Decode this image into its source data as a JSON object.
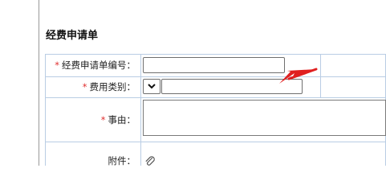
{
  "form": {
    "title": "经费申请单",
    "required_mark": "*",
    "fields": {
      "application_number": {
        "label": "经费申请单编号：",
        "value": ""
      },
      "expense_category": {
        "label": "费用类别：",
        "select_value": "",
        "text_value": ""
      },
      "reason": {
        "label": "事由：",
        "value": ""
      },
      "attachment": {
        "label": "附件："
      }
    }
  },
  "icons": {
    "dropdown": "chevron-down-icon",
    "attachment": "paperclip-icon"
  },
  "colors": {
    "cell_border": "#b9cde4",
    "required_mark": "#e03131",
    "annotation_arrow": "#e02020"
  }
}
